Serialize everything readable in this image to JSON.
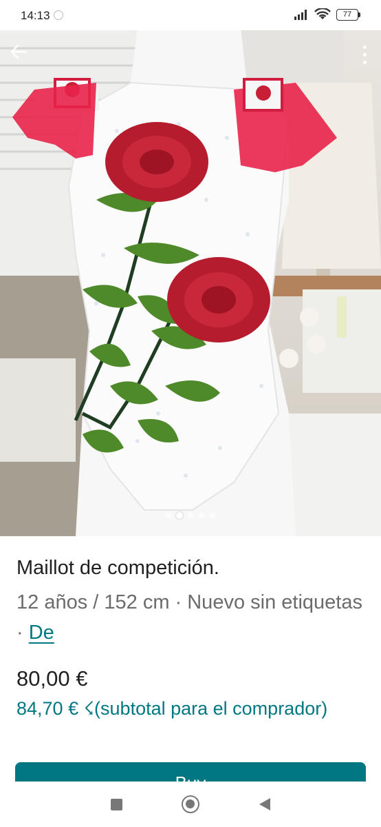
{
  "status_bar": {
    "time": "14:13",
    "battery": "77",
    "icons": [
      "dnd-icon",
      "signal-icon",
      "wifi-icon",
      "battery-icon"
    ]
  },
  "gallery": {
    "image_count": 5,
    "active_index": 1,
    "image_alt": "white competition leotard with red roses"
  },
  "item": {
    "title": "Maillot de competición.",
    "meta_text": "12 años / 152 cm · Nuevo sin etiquetas · ",
    "meta_link": "De",
    "price": "80,00 €",
    "subtotal": "84,70 € ☇(subtotal para el comprador)"
  },
  "actions": {
    "buy_label": "Buy"
  },
  "colors": {
    "accent": "#007782",
    "text": "#1f1f1f",
    "muted": "#6b6b6b"
  }
}
